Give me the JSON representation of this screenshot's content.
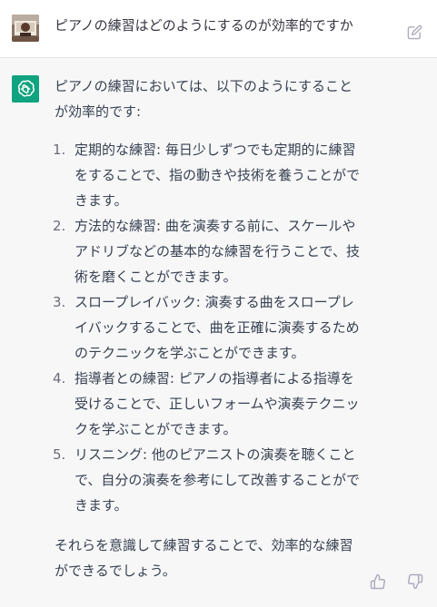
{
  "user_message": {
    "text": "ピアノの練習はどのようにするのが効率的ですか",
    "avatar_icon": "user-photo-avatar",
    "edit_icon": "edit-icon"
  },
  "assistant_message": {
    "avatar_icon": "openai-logo-icon",
    "intro": "ピアノの練習においては、以下のようにすることが効率的です:",
    "items": [
      {
        "num": "1.",
        "text": "定期的な練習: 毎日少しずつでも定期的に練習をすることで、指の動きや技術を養うことができます。"
      },
      {
        "num": "2.",
        "text": "方法的な練習: 曲を演奏する前に、スケールやアドリブなどの基本的な練習を行うことで、技術を磨くことができます。"
      },
      {
        "num": "3.",
        "text": "スロープレイバック: 演奏する曲をスロープレイバックすることで、曲を正確に演奏するためのテクニックを学ぶことができます。"
      },
      {
        "num": "4.",
        "text": "指導者との練習: ピアノの指導者による指導を受けることで、正しいフォームや演奏テクニックを学ぶことができます。"
      },
      {
        "num": "5.",
        "text": "リスニング: 他のピアニストの演奏を聴くことで、自分の演奏を参考にして改善することができます。"
      }
    ],
    "outro": "それらを意識して練習することで、効率的な練習ができるでしょう。",
    "actions": {
      "thumbs_up_icon": "thumbs-up-icon",
      "thumbs_down_icon": "thumbs-down-icon"
    }
  },
  "colors": {
    "accent": "#10a37f",
    "text": "#374151",
    "assistant_bg": "#f7f7f8",
    "user_bg": "#ffffff"
  }
}
